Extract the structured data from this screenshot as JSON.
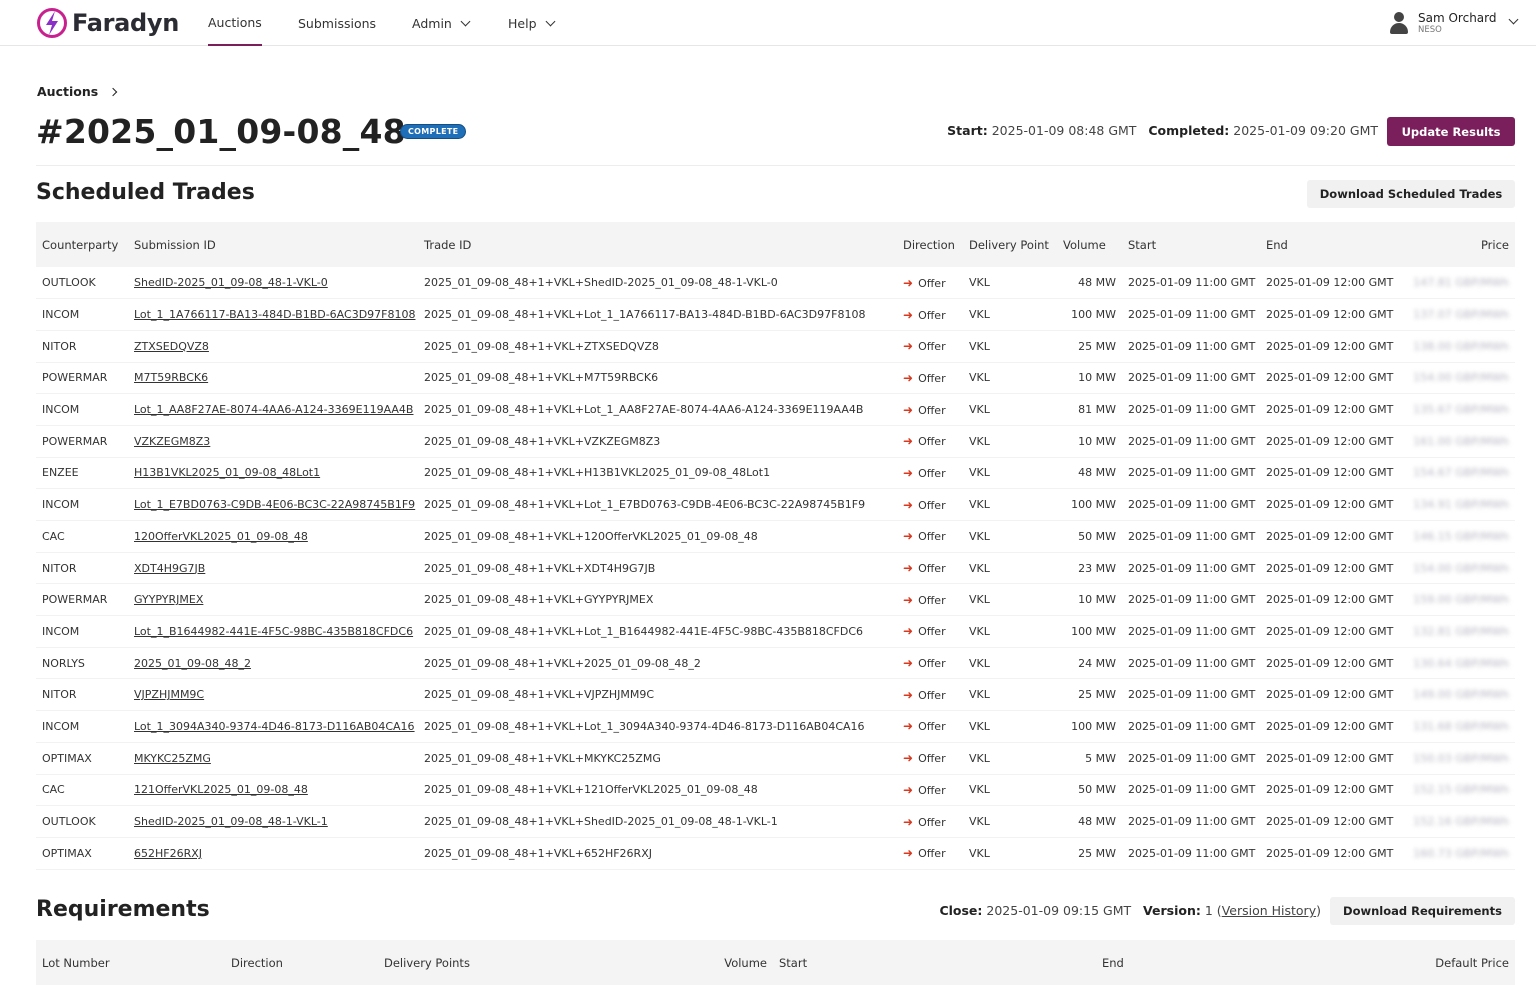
{
  "app": {
    "name": "Faradyn"
  },
  "nav": {
    "items": [
      {
        "label": "Auctions"
      },
      {
        "label": "Submissions"
      },
      {
        "label": "Admin"
      },
      {
        "label": "Help"
      }
    ]
  },
  "user": {
    "name": "Sam Orchard",
    "org": "NESO"
  },
  "breadcrumb": {
    "label": "Auctions"
  },
  "auction": {
    "title": "#2025_01_09-08_48",
    "status": "COMPLETE",
    "start_label": "Start:",
    "start": "2025-01-09 08:48 GMT",
    "completed_label": "Completed:",
    "completed": "2025-01-09 09:20 GMT",
    "update_button": "Update Results"
  },
  "trades": {
    "title": "Scheduled Trades",
    "download_button": "Download Scheduled Trades",
    "columns": [
      "Counterparty",
      "Submission ID",
      "Trade ID",
      "Direction",
      "Delivery Point",
      "Volume",
      "Start",
      "End",
      "Price"
    ],
    "rows": [
      {
        "counterparty": "OUTLOOK",
        "submission_id": "ShedID-2025_01_09-08_48-1-VKL-0",
        "trade_id": "2025_01_09-08_48+1+VKL+ShedID-2025_01_09-08_48-1-VKL-0",
        "direction": "Offer",
        "delivery_point": "VKL",
        "volume": "48 MW",
        "start": "2025-01-09 11:00 GMT",
        "end": "2025-01-09 12:00 GMT",
        "price": "147.81 GBP/MWh"
      },
      {
        "counterparty": "INCOM",
        "submission_id": "Lot_1_1A766117-BA13-484D-B1BD-6AC3D97F8108",
        "trade_id": "2025_01_09-08_48+1+VKL+Lot_1_1A766117-BA13-484D-B1BD-6AC3D97F8108",
        "direction": "Offer",
        "delivery_point": "VKL",
        "volume": "100 MW",
        "start": "2025-01-09 11:00 GMT",
        "end": "2025-01-09 12:00 GMT",
        "price": "137.07 GBP/MWh"
      },
      {
        "counterparty": "NITOR",
        "submission_id": "ZTXSEDQVZ8",
        "trade_id": "2025_01_09-08_48+1+VKL+ZTXSEDQVZ8",
        "direction": "Offer",
        "delivery_point": "VKL",
        "volume": "25 MW",
        "start": "2025-01-09 11:00 GMT",
        "end": "2025-01-09 12:00 GMT",
        "price": "138.00 GBP/MWh"
      },
      {
        "counterparty": "POWERMAR",
        "submission_id": "M7T59RBCK6",
        "trade_id": "2025_01_09-08_48+1+VKL+M7T59RBCK6",
        "direction": "Offer",
        "delivery_point": "VKL",
        "volume": "10 MW",
        "start": "2025-01-09 11:00 GMT",
        "end": "2025-01-09 12:00 GMT",
        "price": "154.00 GBP/MWh"
      },
      {
        "counterparty": "INCOM",
        "submission_id": "Lot_1_AA8F27AE-8074-4AA6-A124-3369E119AA4B",
        "trade_id": "2025_01_09-08_48+1+VKL+Lot_1_AA8F27AE-8074-4AA6-A124-3369E119AA4B",
        "direction": "Offer",
        "delivery_point": "VKL",
        "volume": "81 MW",
        "start": "2025-01-09 11:00 GMT",
        "end": "2025-01-09 12:00 GMT",
        "price": "135.67 GBP/MWh"
      },
      {
        "counterparty": "POWERMAR",
        "submission_id": "VZKZEGM8Z3",
        "trade_id": "2025_01_09-08_48+1+VKL+VZKZEGM8Z3",
        "direction": "Offer",
        "delivery_point": "VKL",
        "volume": "10 MW",
        "start": "2025-01-09 11:00 GMT",
        "end": "2025-01-09 12:00 GMT",
        "price": "161.00 GBP/MWh"
      },
      {
        "counterparty": "ENZEE",
        "submission_id": "H13B1VKL2025_01_09-08_48Lot1",
        "trade_id": "2025_01_09-08_48+1+VKL+H13B1VKL2025_01_09-08_48Lot1",
        "direction": "Offer",
        "delivery_point": "VKL",
        "volume": "48 MW",
        "start": "2025-01-09 11:00 GMT",
        "end": "2025-01-09 12:00 GMT",
        "price": "154.67 GBP/MWh"
      },
      {
        "counterparty": "INCOM",
        "submission_id": "Lot_1_E7BD0763-C9DB-4E06-BC3C-22A98745B1F9",
        "trade_id": "2025_01_09-08_48+1+VKL+Lot_1_E7BD0763-C9DB-4E06-BC3C-22A98745B1F9",
        "direction": "Offer",
        "delivery_point": "VKL",
        "volume": "100 MW",
        "start": "2025-01-09 11:00 GMT",
        "end": "2025-01-09 12:00 GMT",
        "price": "134.91 GBP/MWh"
      },
      {
        "counterparty": "CAC",
        "submission_id": "120OfferVKL2025_01_09-08_48",
        "trade_id": "2025_01_09-08_48+1+VKL+120OfferVKL2025_01_09-08_48",
        "direction": "Offer",
        "delivery_point": "VKL",
        "volume": "50 MW",
        "start": "2025-01-09 11:00 GMT",
        "end": "2025-01-09 12:00 GMT",
        "price": "146.15 GBP/MWh"
      },
      {
        "counterparty": "NITOR",
        "submission_id": "XDT4H9G7JB",
        "trade_id": "2025_01_09-08_48+1+VKL+XDT4H9G7JB",
        "direction": "Offer",
        "delivery_point": "VKL",
        "volume": "23 MW",
        "start": "2025-01-09 11:00 GMT",
        "end": "2025-01-09 12:00 GMT",
        "price": "154.00 GBP/MWh"
      },
      {
        "counterparty": "POWERMAR",
        "submission_id": "GYYPYRJMEX",
        "trade_id": "2025_01_09-08_48+1+VKL+GYYPYRJMEX",
        "direction": "Offer",
        "delivery_point": "VKL",
        "volume": "10 MW",
        "start": "2025-01-09 11:00 GMT",
        "end": "2025-01-09 12:00 GMT",
        "price": "159.00 GBP/MWh"
      },
      {
        "counterparty": "INCOM",
        "submission_id": "Lot_1_B1644982-441E-4F5C-98BC-435B818CFDC6",
        "trade_id": "2025_01_09-08_48+1+VKL+Lot_1_B1644982-441E-4F5C-98BC-435B818CFDC6",
        "direction": "Offer",
        "delivery_point": "VKL",
        "volume": "100 MW",
        "start": "2025-01-09 11:00 GMT",
        "end": "2025-01-09 12:00 GMT",
        "price": "132.81 GBP/MWh"
      },
      {
        "counterparty": "NORLYS",
        "submission_id": "2025_01_09-08_48_2",
        "trade_id": "2025_01_09-08_48+1+VKL+2025_01_09-08_48_2",
        "direction": "Offer",
        "delivery_point": "VKL",
        "volume": "24 MW",
        "start": "2025-01-09 11:00 GMT",
        "end": "2025-01-09 12:00 GMT",
        "price": "130.64 GBP/MWh"
      },
      {
        "counterparty": "NITOR",
        "submission_id": "VJPZHJMM9C",
        "trade_id": "2025_01_09-08_48+1+VKL+VJPZHJMM9C",
        "direction": "Offer",
        "delivery_point": "VKL",
        "volume": "25 MW",
        "start": "2025-01-09 11:00 GMT",
        "end": "2025-01-09 12:00 GMT",
        "price": "149.00 GBP/MWh"
      },
      {
        "counterparty": "INCOM",
        "submission_id": "Lot_1_3094A340-9374-4D46-8173-D116AB04CA16",
        "trade_id": "2025_01_09-08_48+1+VKL+Lot_1_3094A340-9374-4D46-8173-D116AB04CA16",
        "direction": "Offer",
        "delivery_point": "VKL",
        "volume": "100 MW",
        "start": "2025-01-09 11:00 GMT",
        "end": "2025-01-09 12:00 GMT",
        "price": "131.68 GBP/MWh"
      },
      {
        "counterparty": "OPTIMAX",
        "submission_id": "MKYKC25ZMG",
        "trade_id": "2025_01_09-08_48+1+VKL+MKYKC25ZMG",
        "direction": "Offer",
        "delivery_point": "VKL",
        "volume": "5 MW",
        "start": "2025-01-09 11:00 GMT",
        "end": "2025-01-09 12:00 GMT",
        "price": "150.03 GBP/MWh"
      },
      {
        "counterparty": "CAC",
        "submission_id": "121OfferVKL2025_01_09-08_48",
        "trade_id": "2025_01_09-08_48+1+VKL+121OfferVKL2025_01_09-08_48",
        "direction": "Offer",
        "delivery_point": "VKL",
        "volume": "50 MW",
        "start": "2025-01-09 11:00 GMT",
        "end": "2025-01-09 12:00 GMT",
        "price": "152.15 GBP/MWh"
      },
      {
        "counterparty": "OUTLOOK",
        "submission_id": "ShedID-2025_01_09-08_48-1-VKL-1",
        "trade_id": "2025_01_09-08_48+1+VKL+ShedID-2025_01_09-08_48-1-VKL-1",
        "direction": "Offer",
        "delivery_point": "VKL",
        "volume": "48 MW",
        "start": "2025-01-09 11:00 GMT",
        "end": "2025-01-09 12:00 GMT",
        "price": "152.16 GBP/MWh"
      },
      {
        "counterparty": "OPTIMAX",
        "submission_id": "652HF26RXJ",
        "trade_id": "2025_01_09-08_48+1+VKL+652HF26RXJ",
        "direction": "Offer",
        "delivery_point": "VKL",
        "volume": "25 MW",
        "start": "2025-01-09 11:00 GMT",
        "end": "2025-01-09 12:00 GMT",
        "price": "160.73 GBP/MWh"
      }
    ]
  },
  "requirements": {
    "title": "Requirements",
    "close_label": "Close:",
    "close": "2025-01-09 09:15 GMT",
    "version_label": "Version:",
    "version": "1",
    "version_history": "Version History",
    "download_button": "Download Requirements",
    "columns": [
      "Lot Number",
      "Direction",
      "Delivery Points",
      "Volume",
      "Start",
      "End",
      "Default Price"
    ]
  },
  "icons": {
    "direction": "arrow-right-icon",
    "user": "user-icon",
    "logo": "faradyn-logo-icon"
  },
  "colors": {
    "brand": "#7b1f5c",
    "badge": "#1f6fb8",
    "offer_arrow": "#d9381e"
  }
}
